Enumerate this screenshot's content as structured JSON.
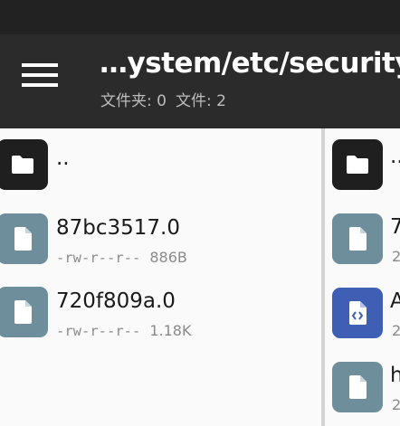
{
  "header": {
    "title": "…ystem/etc/security",
    "folders_label": "文件夹:",
    "folders_count": "0",
    "files_label": "文件:",
    "files_count": "2",
    "menu_icon": "hamburger-menu-icon"
  },
  "left_pane": {
    "parent": {
      "name": "..",
      "icon": "folder-icon"
    },
    "files": [
      {
        "name": "87bc3517.0",
        "permissions": "-rw-r--r--",
        "size": "886B",
        "icon": "file-icon"
      },
      {
        "name": "720f809a.0",
        "permissions": "-rw-r--r--",
        "size": "1.18K",
        "icon": "file-icon"
      }
    ]
  },
  "right_pane": {
    "items": [
      {
        "name": "..",
        "meta": "",
        "icon": "folder-icon"
      },
      {
        "name": "7",
        "meta": "2",
        "icon": "file-icon"
      },
      {
        "name": "A",
        "meta": "2",
        "icon": "code-file-icon"
      },
      {
        "name": "h",
        "meta": "2",
        "icon": "file-icon"
      }
    ]
  },
  "colors": {
    "toolbar": "#2b2b2b",
    "statusbar": "#222222",
    "folder_icon_bg": "#1f1f1f",
    "file_icon_bg": "#6f8e9b",
    "code_icon_bg": "#3f5fb5"
  }
}
